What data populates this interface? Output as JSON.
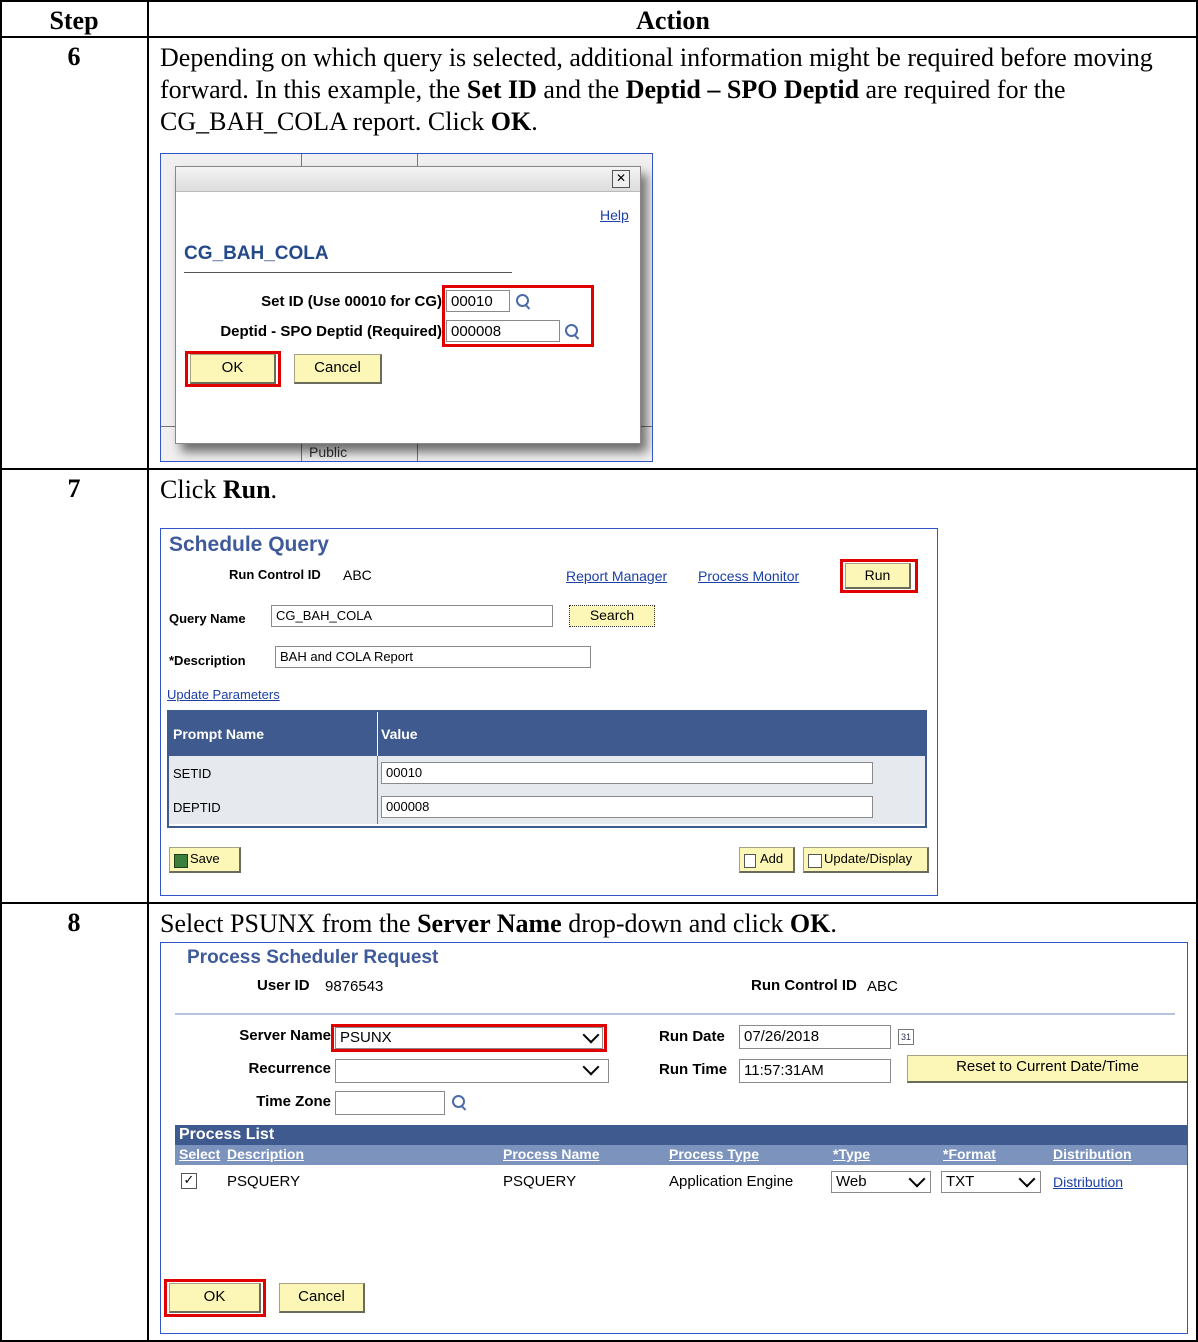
{
  "table": {
    "header_step": "Step",
    "header_action": "Action"
  },
  "step6": {
    "number": "6",
    "text_1": "Depending on which query is selected, additional information might be required before moving forward. In this example, the ",
    "bold_set_id": "Set ID",
    "text_2": " and the ",
    "bold_deptid": "Deptid – SPO Deptid",
    "text_3": " are required for the CG_BAH_COLA report. Click ",
    "bold_ok": "OK",
    "text_4": ".",
    "dialog": {
      "help_link": "Help",
      "title": "CG_BAH_COLA",
      "setid_label": "Set ID (Use 00010 for CG)",
      "setid_value": "00010",
      "deptid_label": "Deptid - SPO Deptid (Required)",
      "deptid_value": "000008",
      "ok_label": "OK",
      "cancel_label": "Cancel",
      "background_text": "Public"
    }
  },
  "step7": {
    "number": "7",
    "text_1": "Click ",
    "bold_run": "Run",
    "text_2": ".",
    "panel": {
      "title": "Schedule Query",
      "run_control_label": "Run Control ID",
      "run_control_value": "ABC",
      "report_manager_link": "Report Manager",
      "process_monitor_link": "Process Monitor",
      "run_label": "Run",
      "query_name_label": "Query Name",
      "query_name_value": "CG_BAH_COLA",
      "search_label": "Search",
      "description_label": "*Description",
      "description_value": "BAH and COLA Report",
      "update_parameters_link": "Update Parameters",
      "grid_headers": [
        "Prompt Name",
        "Value"
      ],
      "grid_rows": [
        {
          "name": "SETID",
          "value": "00010"
        },
        {
          "name": "DEPTID",
          "value": "000008"
        }
      ],
      "save_label": "Save",
      "add_label": "Add",
      "update_display_label": "Update/Display"
    }
  },
  "step8": {
    "number": "8",
    "text_1": "Select PSUNX from the ",
    "bold_server": "Server Name",
    "text_2": " drop-down and click ",
    "bold_ok": "OK",
    "text_3": ".",
    "panel": {
      "title": "Process Scheduler Request",
      "user_id_label": "User ID",
      "user_id_value": "9876543",
      "run_control_label": "Run Control ID",
      "run_control_value": "ABC",
      "server_name_label": "Server Name",
      "server_name_value": "PSUNX",
      "run_date_label": "Run Date",
      "run_date_value": "07/26/2018",
      "calendar_glyph": "31",
      "recurrence_label": "Recurrence",
      "recurrence_value": "",
      "run_time_label": "Run Time",
      "run_time_value": "11:57:31AM",
      "reset_label": "Reset to Current Date/Time",
      "time_zone_label": "Time Zone",
      "time_zone_value": "",
      "process_list_title": "Process List",
      "columns": [
        "Select",
        "Description",
        "Process Name",
        "Process Type",
        "*Type",
        "*Format",
        "Distribution"
      ],
      "row": {
        "description": "PSQUERY",
        "process_name": "PSQUERY",
        "process_type": "Application Engine",
        "type": "Web",
        "format": "TXT",
        "distribution": "Distribution"
      },
      "ok_label": "OK",
      "cancel_label": "Cancel"
    }
  }
}
